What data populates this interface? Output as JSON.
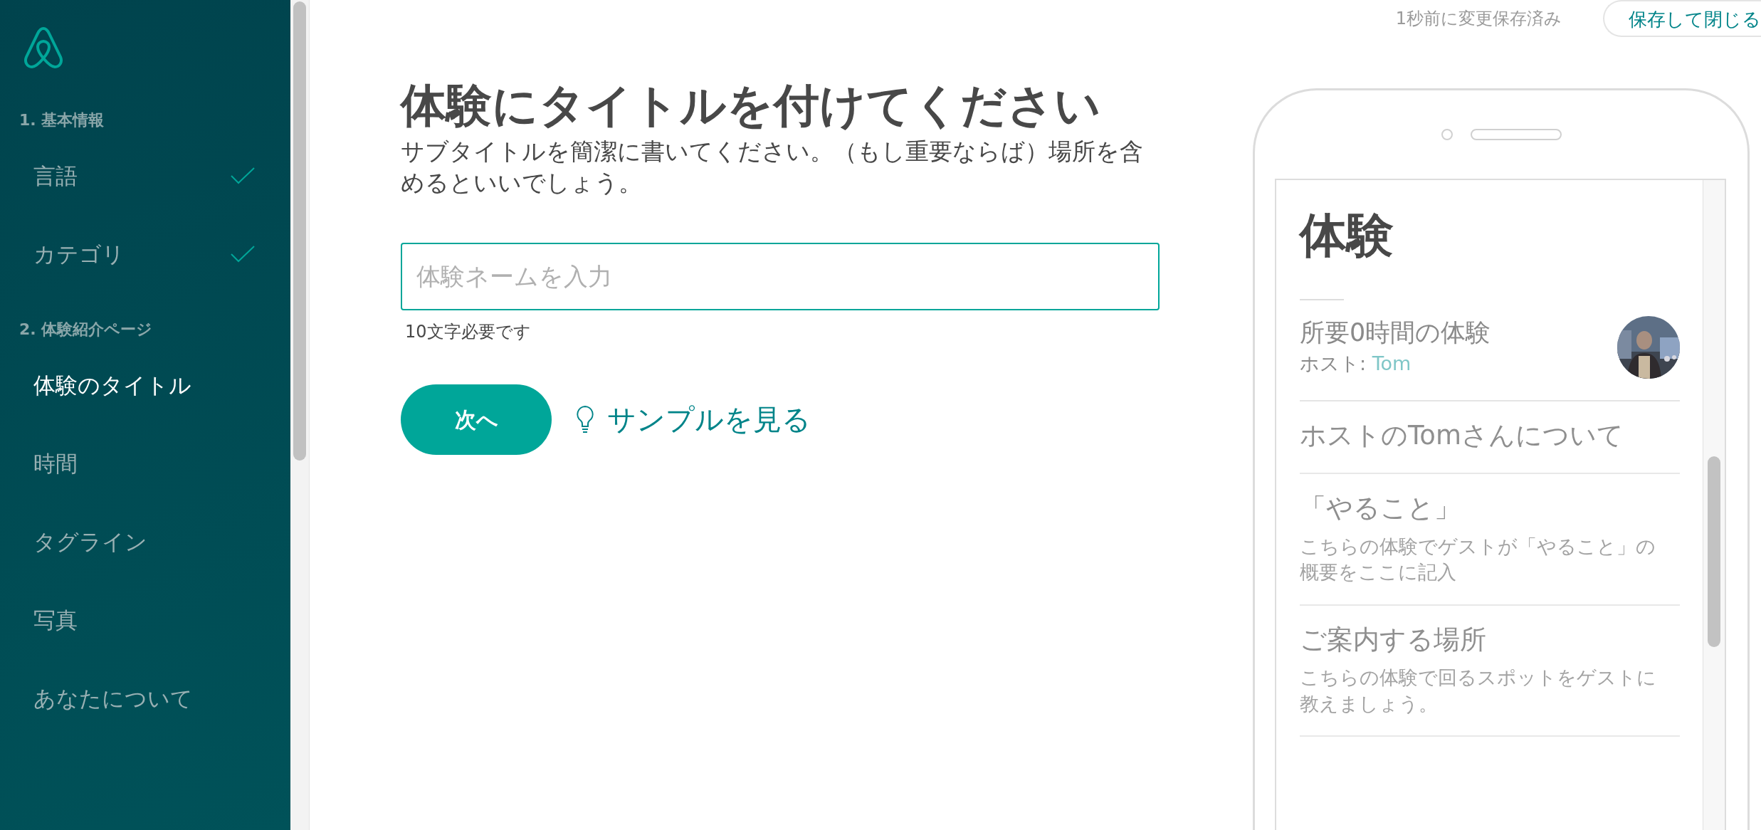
{
  "sidebar": {
    "sections": [
      {
        "title": "1. 基本情報",
        "items": [
          {
            "label": "言語",
            "selected": false,
            "completed": true
          },
          {
            "label": "カテゴリ",
            "selected": false,
            "completed": true
          }
        ]
      },
      {
        "title": "2. 体験紹介ページ",
        "items": [
          {
            "label": "体験のタイトル",
            "selected": true,
            "completed": false
          },
          {
            "label": "時間",
            "selected": false,
            "completed": false
          },
          {
            "label": "タグライン",
            "selected": false,
            "completed": false
          },
          {
            "label": "写真",
            "selected": false,
            "completed": false
          },
          {
            "label": "あなたについて",
            "selected": false,
            "completed": false
          }
        ]
      }
    ]
  },
  "save_status": "1秒前に変更保存済み",
  "save_button": "保存して閉じる",
  "main": {
    "heading": "体験にタイトルを付けてください",
    "subtitle": "サブタイトルを簡潔に書いてください。（もし重要ならば）場所を含めるといいでしょう。",
    "input": {
      "placeholder": "体験ネームを入力"
    },
    "hint": "10文字必要です",
    "next_button": "次へ",
    "sample_link": "サンプルを見る"
  },
  "preview": {
    "title": "体験",
    "duration": "所要0時間の体験",
    "host_label": "ホスト: ",
    "host_name": "Tom",
    "sections": [
      {
        "title": "ホストのTomさんについて"
      },
      {
        "title": "「やること」",
        "description": "こちらの体験でゲストが「やること」の概要をここに記入"
      },
      {
        "title": "ご案内する場所",
        "description": "こちらの体験で回るスポットをゲストに教えましょう。"
      }
    ]
  }
}
